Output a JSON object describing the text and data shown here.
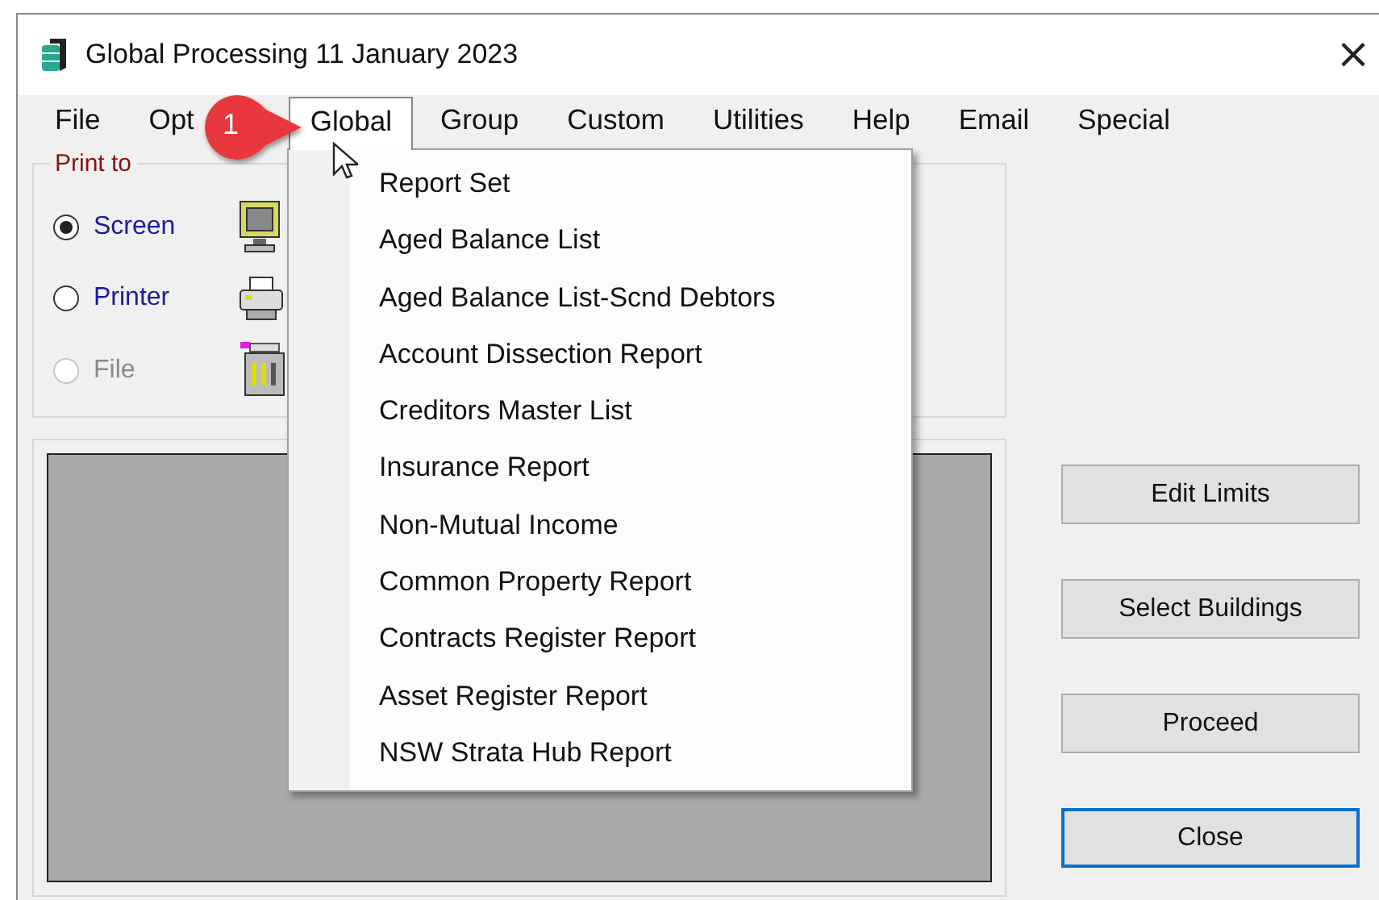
{
  "window": {
    "title": "Global Processing 11 January 2023",
    "close": "×"
  },
  "menu_bar": [
    {
      "label": "File",
      "selected": false
    },
    {
      "label": "Opt",
      "selected": false
    },
    {
      "label": "Global",
      "selected": true
    },
    {
      "label": "Group",
      "selected": false
    },
    {
      "label": "Custom",
      "selected": false
    },
    {
      "label": "Utilities",
      "selected": false
    },
    {
      "label": "Help",
      "selected": false
    },
    {
      "label": "Email",
      "selected": false
    },
    {
      "label": "Special",
      "selected": false
    }
  ],
  "callout": {
    "label": "1"
  },
  "dropdown": {
    "items": [
      "Report Set",
      "Aged Balance List",
      "Aged Balance List-Scnd Debtors",
      "Account Dissection Report",
      "Creditors Master List",
      "Insurance Report",
      "Non-Mutual Income",
      "Common Property Report",
      "Contracts Register Report",
      "Asset Register Report",
      "NSW Strata Hub Report"
    ]
  },
  "print_to": {
    "title": "Print to",
    "options": [
      {
        "label": "Screen",
        "kind": "monitor",
        "selected": true,
        "disabled": false
      },
      {
        "label": "Printer",
        "kind": "printer",
        "selected": false,
        "disabled": false
      },
      {
        "label": "File",
        "kind": "cabinet",
        "selected": false,
        "disabled": true
      }
    ]
  },
  "buttons": [
    {
      "label": "Edit Limits",
      "focused": false
    },
    {
      "label": "Select Buildings",
      "focused": false
    },
    {
      "label": "Proceed",
      "focused": false
    },
    {
      "label": "Close",
      "focused": true
    }
  ]
}
